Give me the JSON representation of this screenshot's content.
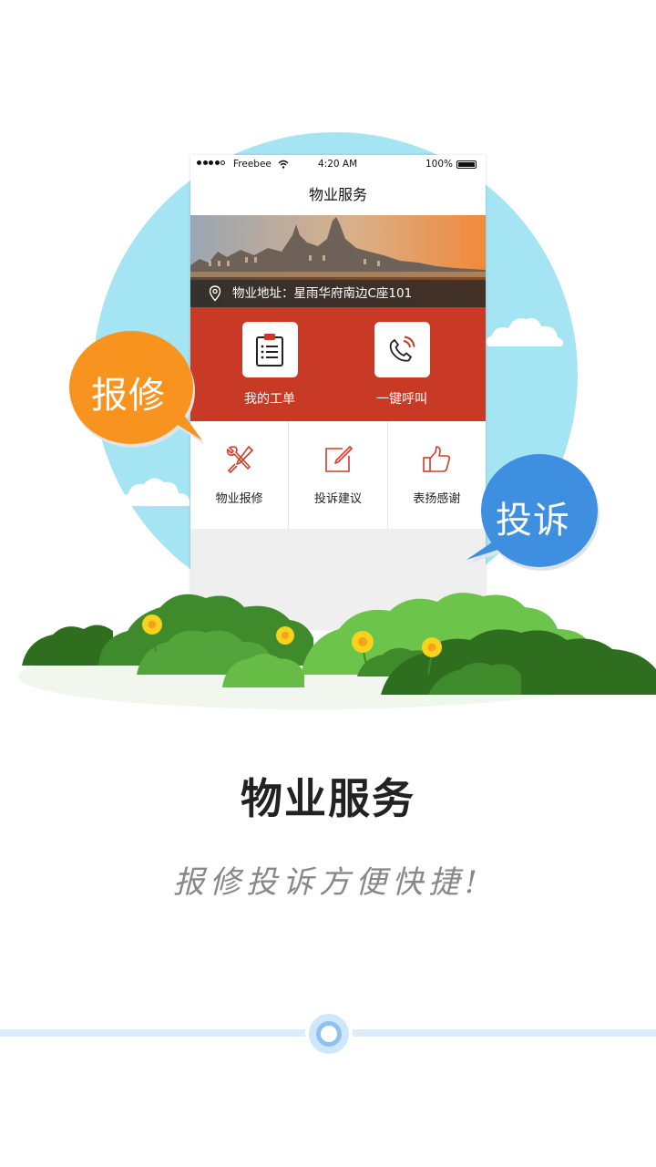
{
  "status_bar": {
    "carrier": "Freebee",
    "time": "4:20 AM",
    "battery": "100%"
  },
  "nav": {
    "title": "物业服务"
  },
  "banner": {
    "address": "物业地址：星雨华府南边C座101"
  },
  "quick_actions": [
    {
      "label": "我的工单",
      "icon": "clipboard-icon"
    },
    {
      "label": "一键呼叫",
      "icon": "phone-ring-icon"
    }
  ],
  "services": [
    {
      "label": "物业报修",
      "icon": "tools-icon"
    },
    {
      "label": "投诉建议",
      "icon": "edit-icon"
    },
    {
      "label": "表扬感谢",
      "icon": "thumbs-up-icon"
    }
  ],
  "bubbles": {
    "left": "报修",
    "right": "投诉"
  },
  "headline": "物业服务",
  "tagline": "报修投诉方便快捷!",
  "pager": {
    "current": 1
  },
  "colors": {
    "accent_red": "#c93a26",
    "orange_bubble": "#f7931e",
    "blue_bubble": "#3e8fe0",
    "sky": "#a4e4f3"
  }
}
